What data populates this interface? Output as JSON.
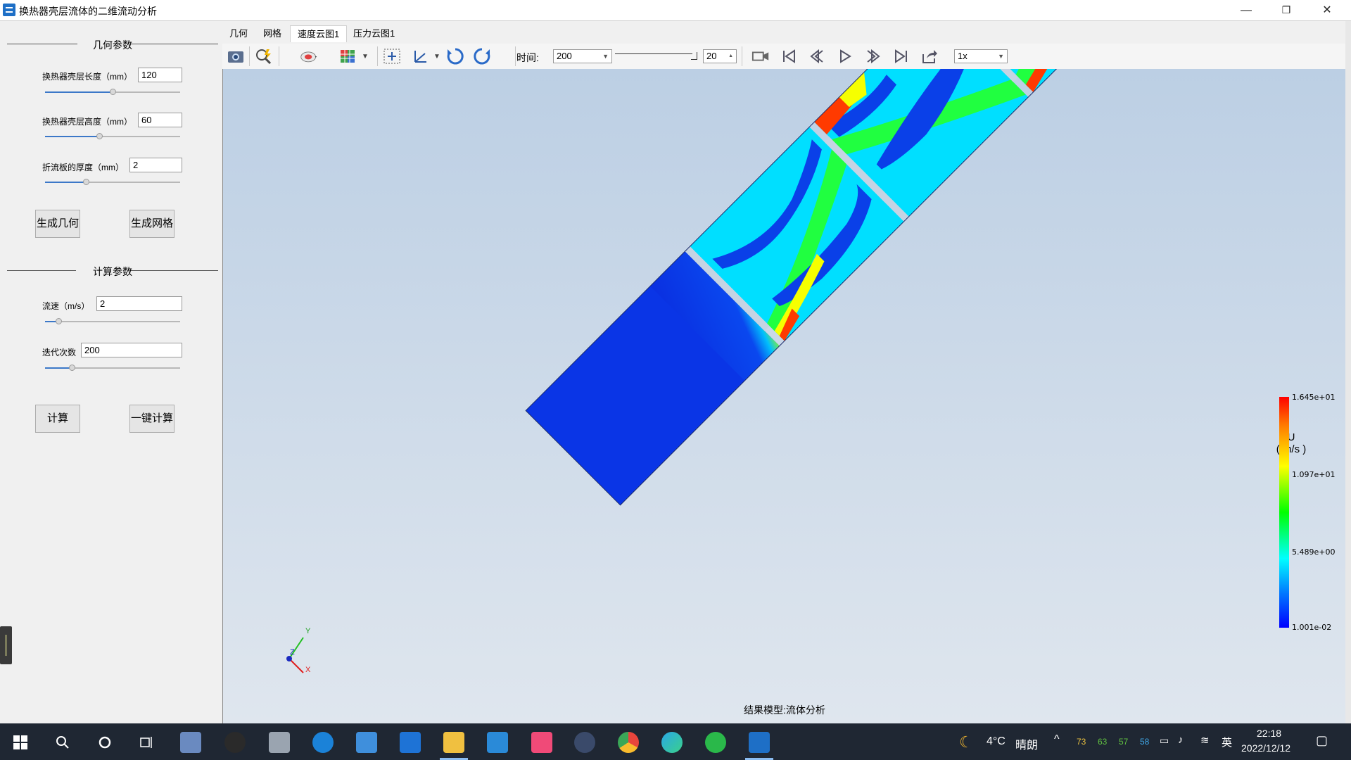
{
  "window": {
    "title": "换热器壳层流体的二维流动分析",
    "minimize": "—",
    "restore": "❐",
    "close": "✕"
  },
  "left_panel": {
    "geometry_group": "几何参数",
    "length_label": "换热器壳层长度（mm）",
    "length_value": "120",
    "length_slider": 0.5,
    "height_label": "换热器壳层高度（mm）",
    "height_value": "60",
    "height_slider": 0.4,
    "baffle_label": "折流板的厚度（mm）",
    "baffle_value": "2",
    "baffle_slider": 0.3,
    "gen_geometry": "生成几何",
    "gen_mesh": "生成网格",
    "compute_group": "计算参数",
    "velocity_label": "流速（m/s）",
    "velocity_value": "2",
    "velocity_slider": 0.1,
    "iter_label": "迭代次数",
    "iter_value": "200",
    "iter_slider": 0.2,
    "compute": "计算",
    "one_click": "一键计算"
  },
  "tabs": [
    "几何",
    "网格",
    "速度云图1",
    "压力云图1"
  ],
  "active_tab": 2,
  "toolbar": {
    "time_label": "时间:",
    "time_value": "200",
    "frame_value": "20",
    "speed_value": "1x",
    "icons": [
      "camera-icon",
      "zoom-icon",
      "surface-icon",
      "mesh-icon",
      "fit-icon",
      "axes-icon",
      "rotate-cw-icon",
      "rotate-ccw-icon",
      "record-icon",
      "first-frame-icon",
      "prev-frame-icon",
      "play-icon",
      "next-frame-icon",
      "last-frame-icon",
      "export-icon"
    ]
  },
  "viewport": {
    "result_label": "结果模型:流体分析",
    "legend": {
      "title_var": "U",
      "title_unit": "( m/s )",
      "max": "1.645e+01",
      "mid_high": "1.097e+01",
      "mid_low": "5.489e+00",
      "min": "1.001e-02"
    },
    "axis_x": "X",
    "axis_y": "Y",
    "axis_z": "Z",
    "colors": {
      "low": "#0a2fe0",
      "mid_low": "#00dfff",
      "mid": "#20ff40",
      "mid_high": "#f6ff00",
      "high": "#ff1e00"
    }
  },
  "taskbar": {
    "weather_temp": "4°C",
    "weather_text": "晴朗",
    "tray_n1": "73",
    "tray_n2": "63",
    "tray_n3": "57",
    "tray_n4": "58",
    "ime": "英",
    "time": "22:18",
    "date": "2022/12/12"
  }
}
